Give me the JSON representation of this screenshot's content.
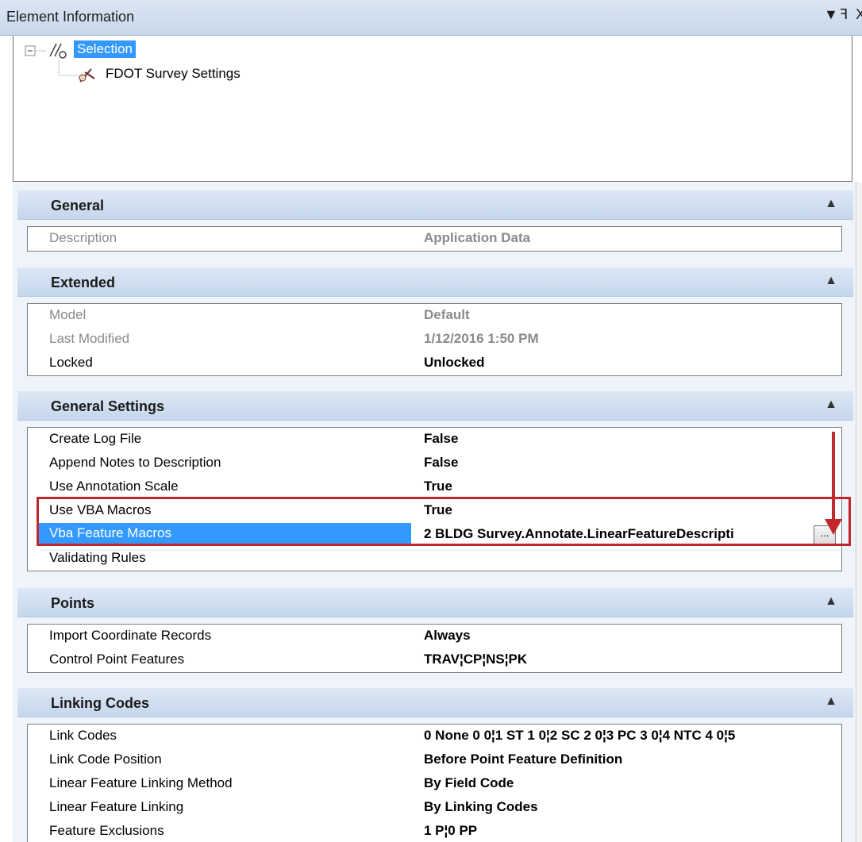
{
  "window": {
    "title": "Element Information",
    "controls": [
      "▼",
      "ꟻ",
      "X"
    ]
  },
  "tree": {
    "root": "Selection",
    "child": "FDOT Survey Settings"
  },
  "sections": [
    {
      "title": "General",
      "rows": [
        {
          "key": "Description",
          "value": "Application Data",
          "dim": true
        }
      ]
    },
    {
      "title": "Extended",
      "rows": [
        {
          "key": "Model",
          "value": "Default",
          "dim": true
        },
        {
          "key": "Last Modified",
          "value": "1/12/2016 1:50 PM",
          "dim": true
        },
        {
          "key": "Locked",
          "value": "Unlocked"
        }
      ]
    },
    {
      "title": "General Settings",
      "rows": [
        {
          "key": "Create Log File",
          "value": "False"
        },
        {
          "key": "Append Notes to Description",
          "value": "False"
        },
        {
          "key": "Use Annotation Scale",
          "value": "True"
        },
        {
          "key": "Use VBA Macros",
          "value": "True"
        },
        {
          "key": "Vba Feature Macros",
          "value": "2 BLDG Survey.Annotate.LinearFeatureDescripti",
          "button": "..."
        },
        {
          "key": "Validating Rules",
          "value": ""
        }
      ]
    },
    {
      "title": "Points",
      "rows": [
        {
          "key": "Import Coordinate Records",
          "value": "Always"
        },
        {
          "key": "Control Point Features",
          "value": "TRAV¦CP¦NS¦PK"
        }
      ]
    },
    {
      "title": "Linking Codes",
      "rows": [
        {
          "key": "Link Codes",
          "value": "0 None 0 0¦1 ST 1 0¦2 SC 2 0¦3 PC 3 0¦4 NTC 4 0¦5"
        },
        {
          "key": "Link Code Position",
          "value": "Before Point Feature Definition"
        },
        {
          "key": "Linear Feature Linking Method",
          "value": "By Field Code"
        },
        {
          "key": "Linear Feature Linking",
          "value": "By Linking Codes"
        },
        {
          "key": "Feature Exclusions",
          "value": "1 P¦0 PP"
        }
      ]
    }
  ],
  "colors": {
    "selection": "#3399ff",
    "annotation": "#c0282e",
    "header_bg": "#c5d6ec"
  }
}
